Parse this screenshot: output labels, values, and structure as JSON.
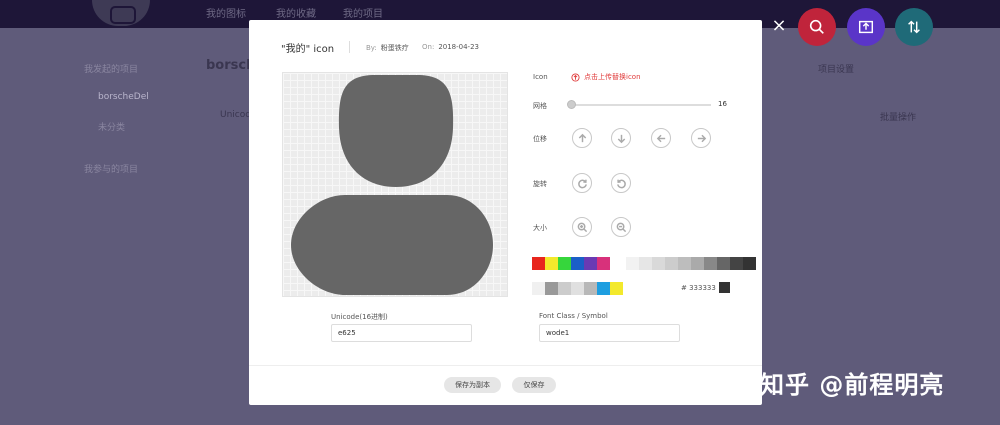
{
  "topnav": [
    "我的图标",
    "我的收藏",
    "我的项目"
  ],
  "background": {
    "title": "borsch",
    "sidebar_items": [
      "我发起的项目",
      "borscheDel",
      "未分类",
      "我参与的项目"
    ],
    "search_hint": "Unicod",
    "right_hint": "批量操作",
    "right_top": "项目设置"
  },
  "top_buttons": [
    {
      "name": "search",
      "color": "#c0243b"
    },
    {
      "name": "upload",
      "color": "#5a35c8"
    },
    {
      "name": "sort",
      "color": "#1f6a78"
    }
  ],
  "close": "×",
  "modal": {
    "title": "\"我的\" icon",
    "by_label": "By:",
    "by_value": "粉蛋铁疗",
    "on_label": "On:",
    "on_value": "2018-04-23",
    "icon_color": "#666666",
    "rows": {
      "icon": "Icon",
      "upload_text": "点击上传替换icon",
      "grid": "网格",
      "grid_value": "16",
      "move": "位移",
      "rotate": "旋转",
      "size": "大小"
    },
    "swatches_row1": [
      "#e8261d",
      "#f3e92c",
      "#36d63c",
      "#1b5fc7",
      "#6a3ab3",
      "#d8317b"
    ],
    "swatches_row1b": [
      "#f2f2f2",
      "#e6e6e6",
      "#d9d9d9",
      "#cccccc",
      "#bdbdbd",
      "#aaaaaa",
      "#888888",
      "#666666",
      "#444444",
      "#333333"
    ],
    "swatches_row2": [
      "#f0f0f0",
      "#999999",
      "#cccccc",
      "#e0e0e0",
      "#b8b8b8",
      "#1e9ee0",
      "#f3e92c"
    ],
    "hex_label": "# 333333",
    "hex_color": "#333333",
    "unicode_label": "Unicode(16进制)",
    "unicode_value": "e625",
    "fontclass_label": "Font Class / Symbol",
    "fontclass_value": "wode1",
    "save_copy": "保存为副本",
    "save_only": "仅保存"
  },
  "watermark": "知乎 @前程明亮"
}
